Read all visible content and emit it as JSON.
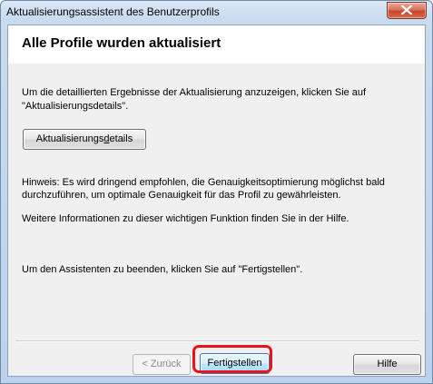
{
  "window": {
    "title": "Aktualisierungsassistent des Benutzerprofils",
    "close_icon": "close-icon",
    "close_color": "#c8452a"
  },
  "header": {
    "title": "Alle Profile wurden aktualisiert"
  },
  "body": {
    "intro_line1": "Um die detaillierten Ergebnisse der Aktualisierung anzuzeigen, klicken Sie auf",
    "intro_line2": "\"Aktualisierungsdetails\".",
    "details_button_label_pre": "Aktualisierungs",
    "details_button_label_accel": "d",
    "details_button_label_post": "etails",
    "hint_line1": "Hinweis: Es wird dringend empfohlen, die Genauigkeitsoptimierung möglichst bald",
    "hint_line2": "durchzuführen, um optimale Genauigkeit für das Profil zu gewährleisten.",
    "info_line": "Weitere Informationen zu dieser wichtigen Funktion finden Sie in der Hilfe.",
    "finish_hint": "Um den Assistenten zu beenden, klicken Sie auf \"Fertigstellen\"."
  },
  "footer": {
    "back_label": "< Zurück",
    "finish_label": "Fertigstellen",
    "help_label": "Hilfe",
    "highlight_color": "#e8141c"
  }
}
